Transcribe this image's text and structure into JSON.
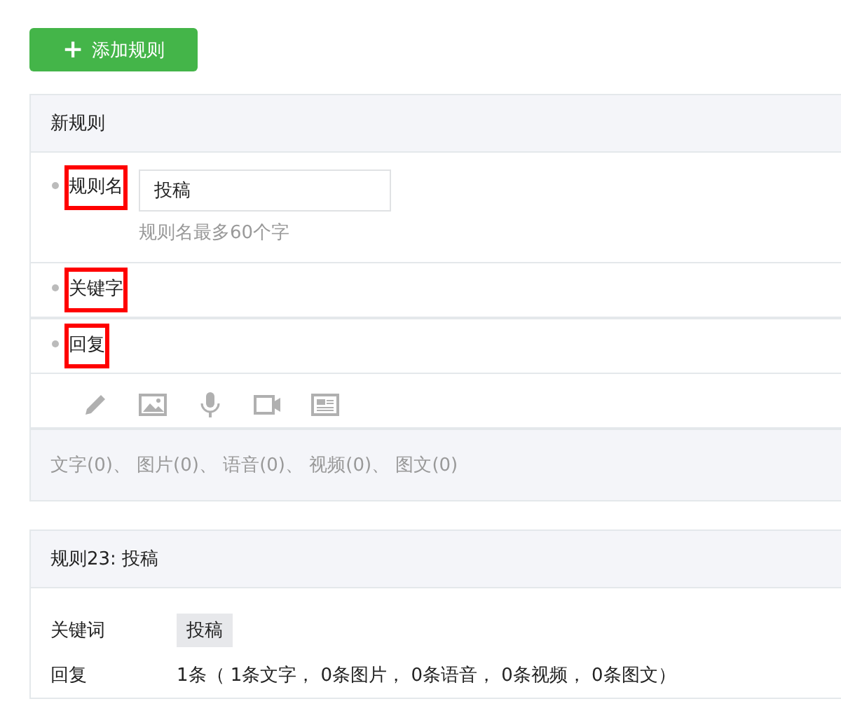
{
  "add_button": {
    "icon": "+",
    "label": "添加规则"
  },
  "new_rule": {
    "title": "新规则",
    "fields": [
      {
        "kind": "name",
        "label": "规则名",
        "highlighted": true,
        "value": "投稿",
        "hint": "规则名最多60个字"
      },
      {
        "kind": "plain",
        "label": "关键字",
        "highlighted": true
      },
      {
        "kind": "plain",
        "label": "回复",
        "highlighted": true
      }
    ],
    "reply_counts": "文字(0)、 图片(0)、 语音(0)、 视频(0)、 图文(0)"
  },
  "saved_rule": {
    "title": "规则23: 投稿",
    "rows": [
      {
        "kind": "tag",
        "label": "关键词",
        "value": "投稿"
      },
      {
        "kind": "text",
        "label": "回复",
        "value": "1条（ 1条文字， 0条图片， 0条语音， 0条视频， 0条图文）"
      }
    ]
  }
}
